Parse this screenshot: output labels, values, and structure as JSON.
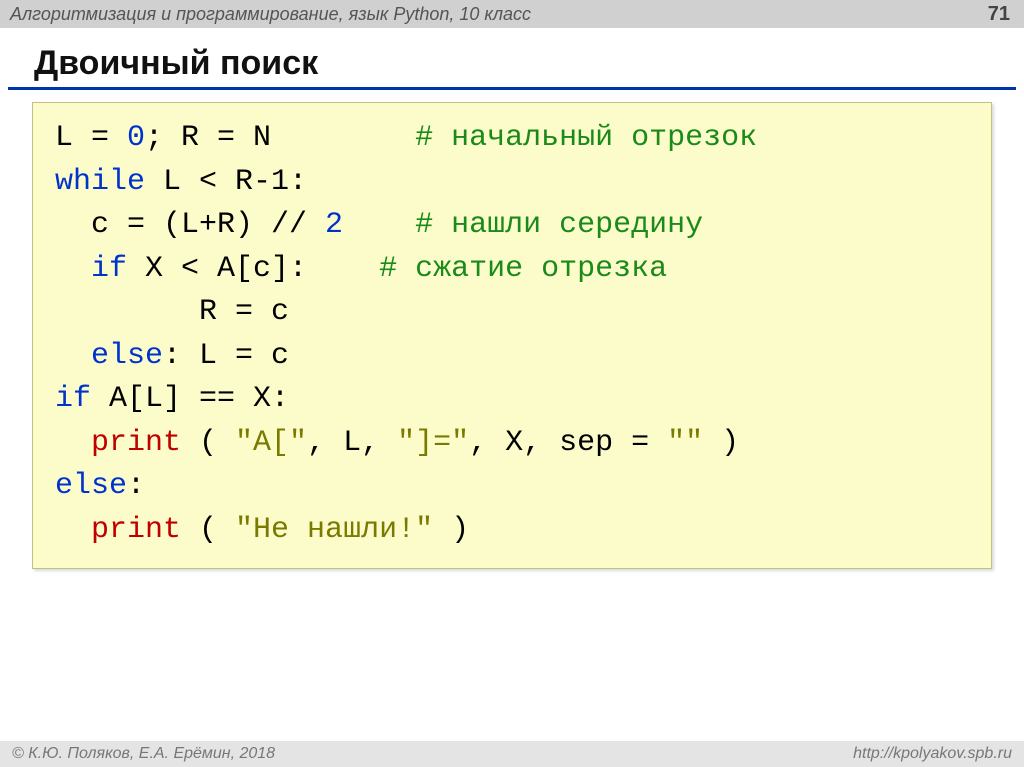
{
  "header": {
    "title": "Алгоритмизация и программирование, язык Python, 10 класс",
    "page": "71"
  },
  "slide": {
    "title": "Двоичный поиск"
  },
  "code": {
    "l1_a": "L = ",
    "l1_b": "0",
    "l1_c": "; R = N        ",
    "l1_d": "# начальный отрезок",
    "l2_a": "while",
    "l2_b": " L < R-1:",
    "l3_a": "  c = (L+R) // ",
    "l3_b": "2",
    "l3_c": "    ",
    "l3_d": "# нашли середину",
    "l4_a": "  ",
    "l4_b": "if",
    "l4_c": " X < A[c]:    ",
    "l4_d": "# сжатие отрезка",
    "l5": "        R = c ",
    "l6_a": "  ",
    "l6_b": "else",
    "l6_c": ": L = c",
    "l7_a": "if",
    "l7_b": " A[L] == X:",
    "l8_a": "  ",
    "l8_b": "print",
    "l8_c": " ( ",
    "l8_d": "\"A[\"",
    "l8_e": ", L, ",
    "l8_f": "\"]=\"",
    "l8_g": ", X, sep = ",
    "l8_h": "\"\"",
    "l8_i": " )",
    "l9_a": "else",
    "l9_b": ":",
    "l10_a": "  ",
    "l10_b": "print",
    "l10_c": " ( ",
    "l10_d": "\"Не нашли!\"",
    "l10_e": " )"
  },
  "footer": {
    "left": "© К.Ю. Поляков, Е.А. Ерёмин, 2018",
    "right": "http://kpolyakov.spb.ru"
  }
}
